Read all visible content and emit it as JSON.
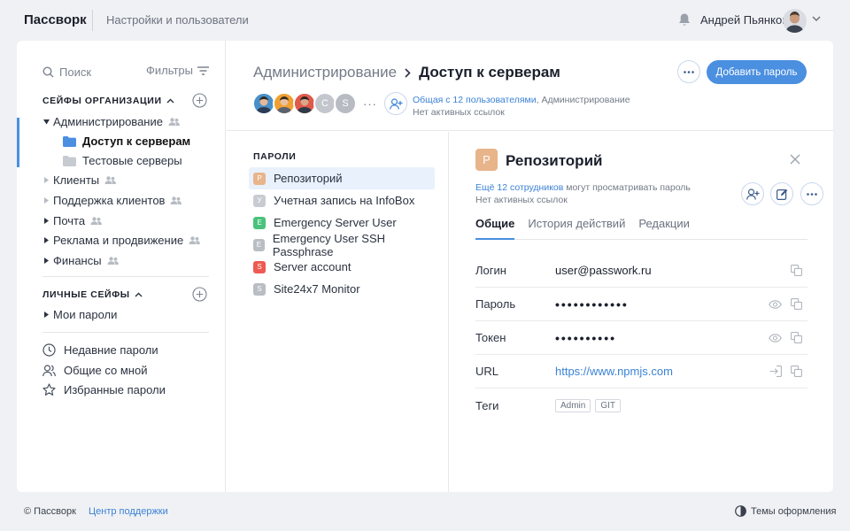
{
  "header": {
    "brand": "Пассворк",
    "settings_link": "Настройки и пользователи",
    "user_name": "Андрей Пьянков",
    "icons": [
      "bell-icon",
      "avatar",
      "chevron-down-icon"
    ]
  },
  "sidebar": {
    "search_label": "Поиск",
    "filters_label": "Фильтры",
    "org_vaults_title": "СЕЙФЫ ОРГАНИЗАЦИИ",
    "org_tree": [
      {
        "label": "Администрирование",
        "expanded": true
      },
      {
        "label": "Доступ к серверам",
        "selected": true
      },
      {
        "label": "Тестовые серверы"
      },
      {
        "label": "Клиенты"
      },
      {
        "label": "Поддержка клиентов"
      },
      {
        "label": "Почта"
      },
      {
        "label": "Реклама и продвижение"
      },
      {
        "label": "Финансы"
      }
    ],
    "personal_vaults_title": "ЛИЧНЫЕ СЕЙФЫ",
    "personal_tree": [
      {
        "label": "Мои пароли"
      }
    ],
    "links": [
      {
        "label": "Недавние пароли",
        "icon": "clock-icon"
      },
      {
        "label": "Общие со мной",
        "icon": "users-icon"
      },
      {
        "label": "Избранные пароли",
        "icon": "star-icon"
      }
    ]
  },
  "content": {
    "breadcrumb_parent": "Администрирование",
    "breadcrumb_current": "Доступ к серверам",
    "add_password_button": "Добавить пароль",
    "share_link": "Общая с 12 пользователями",
    "share_suffix": ", Администрирование",
    "no_links": "Нет активных ссылок",
    "avatar_letters": [
      "C",
      "S"
    ],
    "more_indicator": "···"
  },
  "passwords": {
    "title": "ПАРОЛИ",
    "items": [
      {
        "letter": "Р",
        "label": "Репозиторий",
        "color": "#e8b48a",
        "active": true
      },
      {
        "letter": "У",
        "label": "Учетная запись на InfoBox",
        "color": "#c8ccd2"
      },
      {
        "letter": "E",
        "label": "Emergency Server User",
        "color": "#49c27b"
      },
      {
        "letter": "E",
        "label": "Emergency User SSH Passphrase",
        "color": "#b9bdc4"
      },
      {
        "letter": "S",
        "label": "Server account",
        "color": "#ee5a52"
      },
      {
        "letter": "S",
        "label": "Site24x7 Monitor",
        "color": "#b9bdc4"
      }
    ]
  },
  "detail": {
    "icon_letter": "Р",
    "title": "Репозиторий",
    "share_link": "Ещё 12 сотрудников",
    "share_suffix": " могут просматривать пароль",
    "no_links": "Нет активных ссылок",
    "tabs": [
      "Общие",
      "История действий",
      "Редакции"
    ],
    "fields": [
      {
        "label": "Логин",
        "value": "user@passwork.ru"
      },
      {
        "label": "Пароль",
        "value": "••••••••••••"
      },
      {
        "label": "Токен",
        "value": "••••••••••"
      },
      {
        "label": "URL",
        "value": "https://www.npmjs.com"
      },
      {
        "label": "Теги",
        "tags": [
          "Admin",
          "GIT"
        ]
      }
    ]
  },
  "footer": {
    "copyright": "© Пассворк",
    "support": "Центр поддержки",
    "themes": "Темы оформления"
  },
  "colors": {
    "accent": "#4a8fe0",
    "link": "#3b82d6",
    "active_row": "#e8f1fc"
  }
}
